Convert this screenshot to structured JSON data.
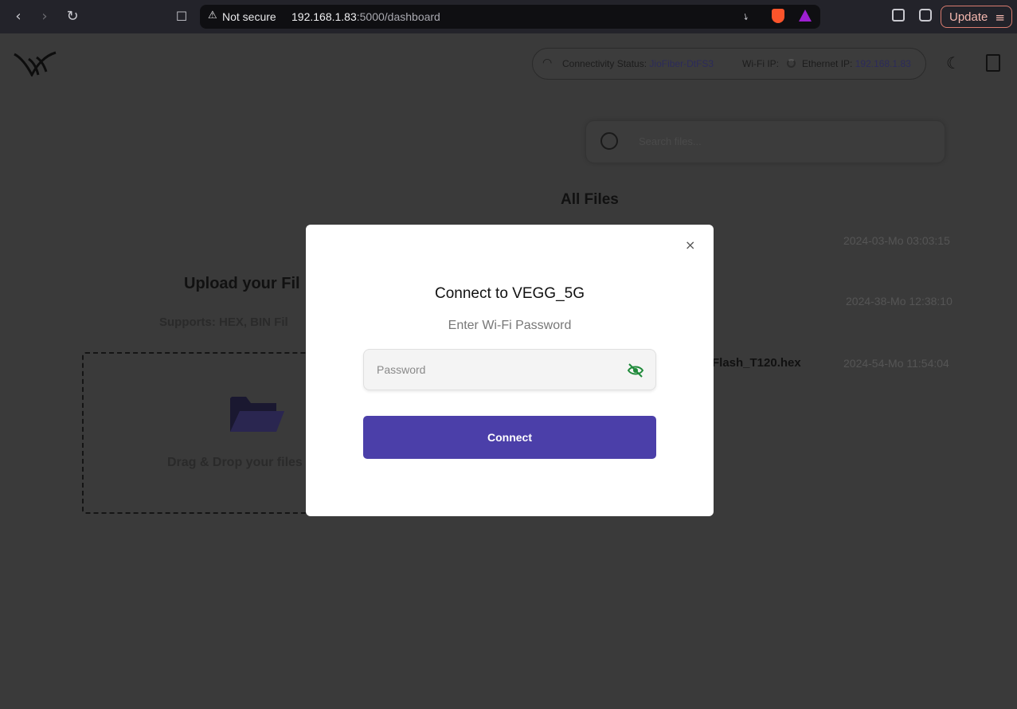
{
  "browser": {
    "back_icon": "chevron-left-icon",
    "forward_icon": "chevron-right-icon",
    "reload_icon": "reload-icon",
    "bookmark_icon": "bookmark-icon",
    "security_label": "Not secure",
    "url_host": "192.168.1.83",
    "url_path": ":5000/dashboard",
    "update_label": "Update"
  },
  "header": {
    "status_label": "Connectivity Status:",
    "network_name": "JioFiber-DtFS3",
    "wifi_ip_label": "Wi-Fi IP:",
    "ethernet_ip_label": "Ethernet IP:",
    "ethernet_ip": "192.168.1.83"
  },
  "files": {
    "search_placeholder": "Search files...",
    "heading": "All Files",
    "items": [
      {
        "name": "",
        "date": "2024-03-Mo 03:03:15"
      },
      {
        "name": "",
        "date": "2024-38-Mo 12:38:10"
      },
      {
        "name": "Flash_T120.hex",
        "date": "2024-54-Mo 11:54:04"
      }
    ]
  },
  "upload": {
    "title": "Upload your Fil",
    "supports": "Supports: HEX, BIN Fil",
    "drop_text": "Drag & Drop your files"
  },
  "modal": {
    "close": "×",
    "title": "Connect to VEGG_5G",
    "subtitle": "Enter Wi-Fi Password",
    "password_placeholder": "Password",
    "connect_label": "Connect"
  },
  "colors": {
    "primary": "#4b3fa9",
    "eye_icon": "#1f8a3a",
    "update_border": "#d97c6f"
  }
}
